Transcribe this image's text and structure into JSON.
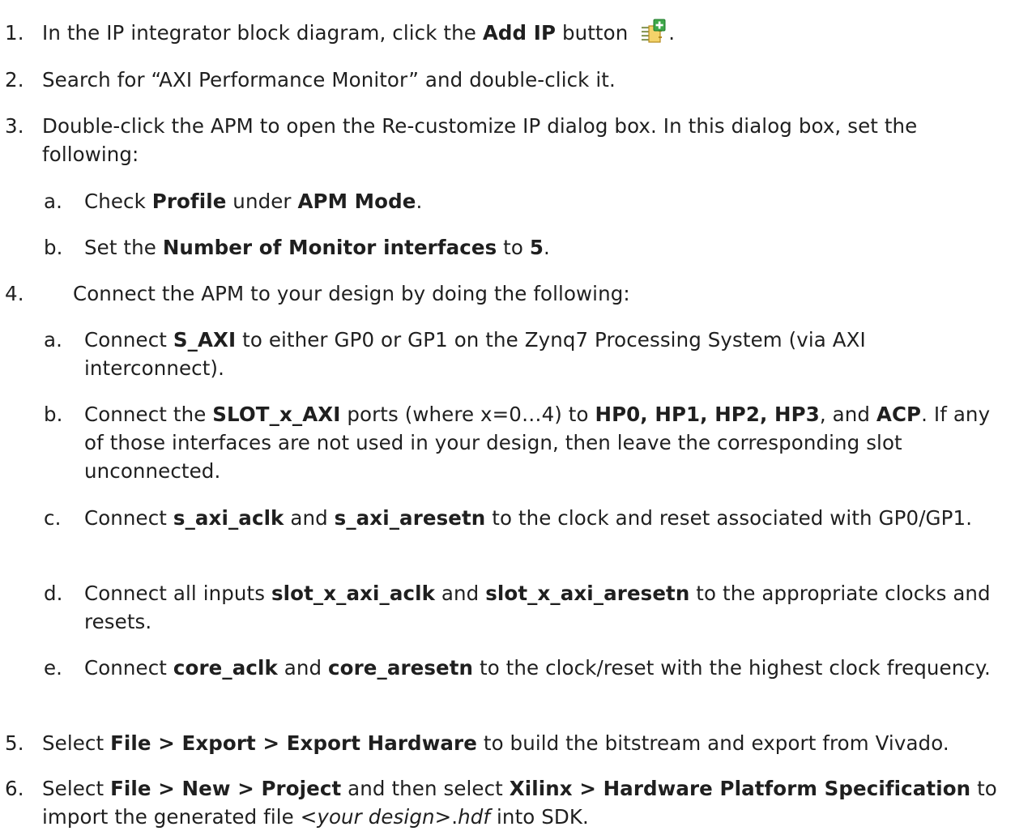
{
  "steps": [
    {
      "num": "1.",
      "t1": "In the IP integrator block diagram, click the ",
      "b1": "Add IP",
      "t2": " button ",
      "t3": ".",
      "icon": "add-ip-icon"
    },
    {
      "num": "2.",
      "t1": "Search for “AXI Performance Monitor” and double-click it."
    },
    {
      "num": "3.",
      "t1": "Double-click the APM to open the Re-customize IP dialog box. In this dialog box, set the following:"
    },
    {
      "num": "a.",
      "t1": "Check ",
      "b1": "Profile",
      "t2": " under ",
      "b2": "APM Mode",
      "t3": "."
    },
    {
      "num": "b.",
      "t1": "Set the ",
      "b1": "Number of Monitor interfaces",
      "t2": " to ",
      "b2": "5",
      "t3": "."
    },
    {
      "num": "4.",
      "t1": "Connect the APM to your design by doing the following:"
    },
    {
      "num": "a.",
      "t1": "Connect ",
      "b1": "S_AXI",
      "t2": " to either GP0 or GP1 on the Zynq7 Processing System (via AXI interconnect)."
    },
    {
      "num": "b.",
      "t1": "Connect the ",
      "b1": "SLOT_x_AXI",
      "t2": " ports (where x=0…4) to ",
      "b2": "HP0, HP1, HP2, HP3",
      "t3": ", and ",
      "b3": "ACP",
      "t4": ". If any of those interfaces are not used in your design, then leave the corresponding slot unconnected."
    },
    {
      "num": "c.",
      "t1": "Connect ",
      "b1": "s_axi_aclk",
      "t2": " and ",
      "b2": "s_axi_aresetn",
      "t3": " to the clock and reset associated with GP0/GP1."
    },
    {
      "num": "d.",
      "t1": "Connect all inputs ",
      "b1": "slot_x_axi_aclk",
      "t2": " and ",
      "b2": "slot_x_axi_aresetn",
      "t3": " to the appropriate clocks and resets."
    },
    {
      "num": "e.",
      "t1": "Connect ",
      "b1": "core_aclk",
      "t2": " and ",
      "b2": "core_aresetn",
      "t3": " to the clock/reset with the highest clock frequency."
    },
    {
      "num": "5.",
      "t1": "Select ",
      "b1": "File > Export > Export Hardware",
      "t2": " to build the bitstream and export from Vivado."
    },
    {
      "num": "6.",
      "t1": "Select ",
      "b1": "File > New > Project",
      "t2": " and then select ",
      "b2": "Xilinx > Hardware Platform Specification",
      "t3": " to import the generated file ",
      "i1": "<your design>",
      "t4": ".",
      "i2": "hdf",
      "t5": " into SDK."
    }
  ]
}
